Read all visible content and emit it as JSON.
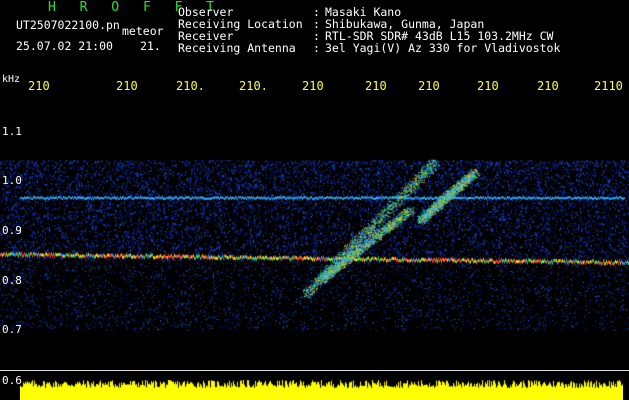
{
  "header": {
    "brand": "H R O F F T",
    "filename": "UT2507022100.pn",
    "mode": "meteor",
    "datetime": "25.07.02 21:00",
    "minute": "21."
  },
  "info": [
    {
      "label": "Observer",
      "value": "Masaki Kano"
    },
    {
      "label": "Receiving Location",
      "value": "Shibukawa, Gunma, Japan"
    },
    {
      "label": "Receiver",
      "value": "RTL-SDR SDR# 43dB L15 103.2MHz CW"
    },
    {
      "label": "Receiving Antenna",
      "value": "3el Yagi(V) Az 330 for Vladivostok"
    }
  ],
  "colon": ":",
  "axis": {
    "unit": "kHz",
    "top_ticks": [
      "210",
      "210",
      "210.",
      "210.",
      "210",
      "210",
      "210",
      "210",
      "210",
      "2110"
    ],
    "y_labels": [
      "1.1",
      "1.0",
      "0.9",
      "0.8",
      "0.7",
      "0.6"
    ]
  },
  "colors": {
    "background": "#000000",
    "brand": "#25e425",
    "tick_labels": "#ffff3c",
    "noise": "#1030c8",
    "carrier": "#ff4020",
    "power_bar": "#ffff00"
  }
}
